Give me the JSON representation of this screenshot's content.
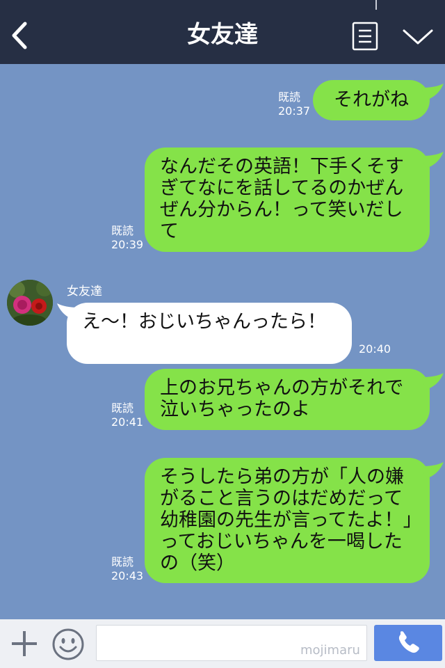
{
  "header": {
    "title": "女友達",
    "back_icon": "chevron-left-icon",
    "menu_icon": "list-menu-icon",
    "collapse_icon": "chevron-down-icon"
  },
  "messages": [
    {
      "side": "right",
      "text": "それがね",
      "read": "既読",
      "time": "20:37"
    },
    {
      "side": "right",
      "text": "なんだその英語！下手くそすぎてなにを話してるのかぜんぜん分からん！って笑いだして",
      "read": "既読",
      "time": "20:39"
    },
    {
      "side": "left",
      "sender": "女友達",
      "text": "え〜！おじいちゃんったら！",
      "time": "20:40"
    },
    {
      "side": "right",
      "text": "上のお兄ちゃんの方がそれで泣いちゃったのよ",
      "read": "既読",
      "time": "20:41"
    },
    {
      "side": "right",
      "text": "そうしたら弟の方が「人の嫌がること言うのはだめだって幼稚園の先生が言ってたよ！」っておじいちゃんを一喝したの（笑）",
      "read": "既読",
      "time": "20:43"
    }
  ],
  "input_bar": {
    "plus_icon": "plus-icon",
    "emoji_icon": "smiley-icon",
    "input_value": "",
    "watermark": "mojimaru",
    "call_icon": "phone-icon"
  },
  "colors": {
    "header_bg": "#262f44",
    "chat_bg": "#7494c4",
    "own_bubble": "#85e249",
    "other_bubble": "#ffffff",
    "call_button": "#5a87e2"
  }
}
